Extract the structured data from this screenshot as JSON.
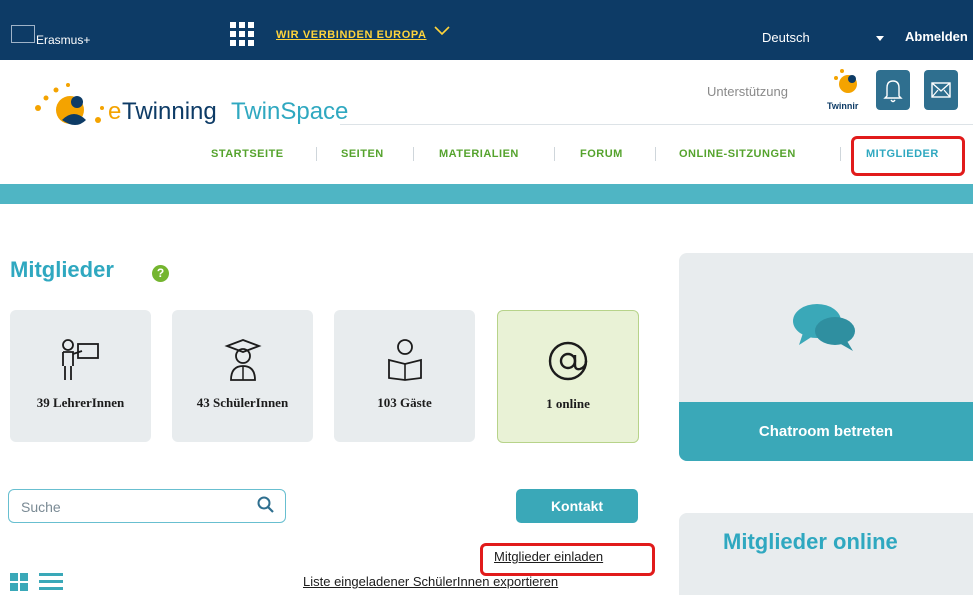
{
  "topbar": {
    "program": "Erasmus+",
    "connect_label": "WIR VERBINDEN EUROPA",
    "language": "Deutsch",
    "logout": "Abmelden"
  },
  "header": {
    "logo_e": "e",
    "logo_twinning": "Twinning",
    "logo_twinspace": "TwinSpace",
    "support": "Unterstützung",
    "mini_logo_text": "Twinnir"
  },
  "nav": {
    "items": [
      "STARTSEITE",
      "SEITEN",
      "MATERIALIEN",
      "FORUM",
      "ONLINE-SITZUNGEN",
      "MITGLIEDER"
    ],
    "active": "MITGLIEDER"
  },
  "page": {
    "title": "Mitglieder",
    "help": "?"
  },
  "stats": [
    {
      "label": "39 LehrerInnen",
      "icon": "teacher-icon"
    },
    {
      "label": "43 SchülerInnen",
      "icon": "student-icon"
    },
    {
      "label": "103 Gäste",
      "icon": "reader-icon"
    },
    {
      "label": "1 online",
      "icon": "at-icon"
    }
  ],
  "search": {
    "placeholder": "Suche"
  },
  "actions": {
    "contact": "Kontakt",
    "invite": "Mitglieder einladen",
    "export": "Liste eingeladener SchülerInnen exportieren"
  },
  "sidebar": {
    "chat_button": "Chatroom betreten",
    "online_title": "Mitglieder online"
  },
  "colors": {
    "topbar": "#0d3b66",
    "accent_teal": "#3aa8b8",
    "nav_green": "#55a32d",
    "highlight_red": "#e11b1b",
    "online_card": "#e9f2d6"
  }
}
